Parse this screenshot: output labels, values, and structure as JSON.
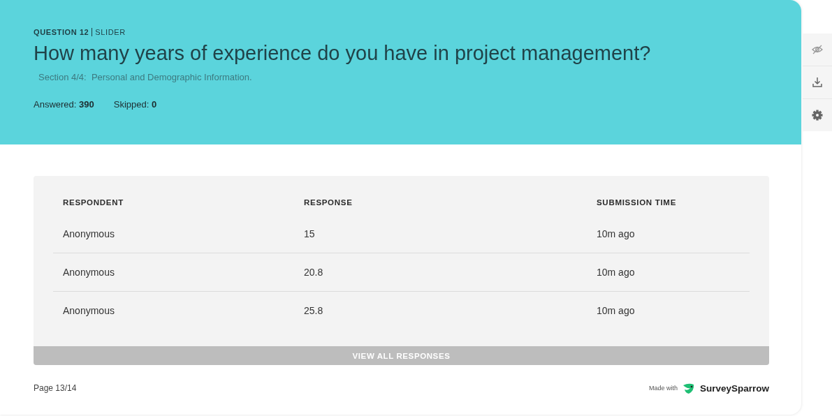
{
  "question": {
    "number_label": "QUESTION 12",
    "type_label": "SLIDER",
    "title": "How many years of experience do you have in project management?",
    "section": "Section 4/4:  Personal and Demographic Information.",
    "answered_label": "Answered:",
    "answered": "390",
    "skipped_label": "Skipped:",
    "skipped": "0"
  },
  "table": {
    "columns": [
      "RESPONDENT",
      "RESPONSE",
      "SUBMISSION TIME"
    ],
    "rows": [
      [
        "Anonymous",
        "15",
        "10m ago"
      ],
      [
        "Anonymous",
        "20.8",
        "10m ago"
      ],
      [
        "Anonymous",
        "25.8",
        "10m ago"
      ]
    ],
    "button": "VIEW ALL RESPONSES"
  },
  "footer": {
    "page": "Page 13/14",
    "made_with": "Made with",
    "brand": "SurveySparrow"
  },
  "toolbar": [
    {
      "kind": "hide"
    },
    {
      "kind": "download"
    },
    {
      "kind": "settings"
    }
  ]
}
